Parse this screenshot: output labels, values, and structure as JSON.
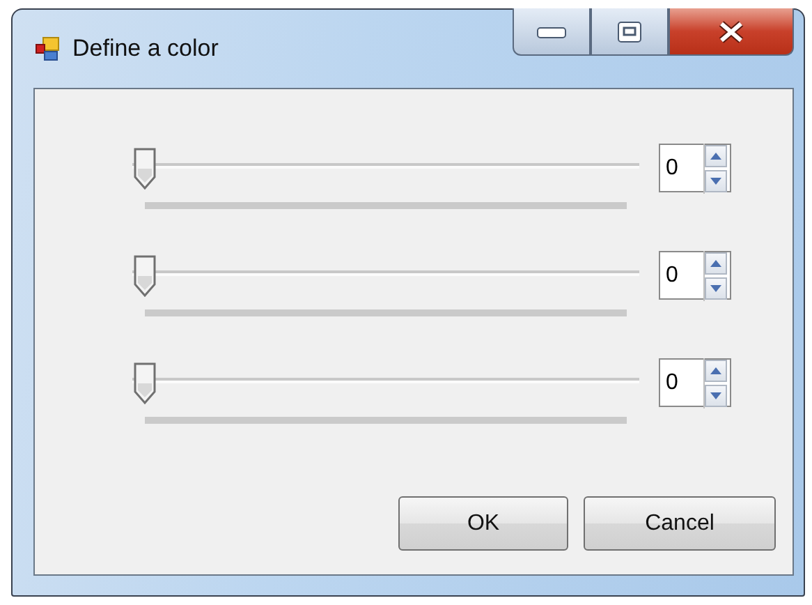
{
  "window": {
    "title": "Define a color"
  },
  "sliders": [
    {
      "level": 0,
      "value": "0"
    },
    {
      "level": 0,
      "value": "0"
    },
    {
      "level": 0,
      "value": "0"
    }
  ],
  "buttons": [
    {
      "label": "OK"
    },
    {
      "label": "Cancel"
    }
  ]
}
